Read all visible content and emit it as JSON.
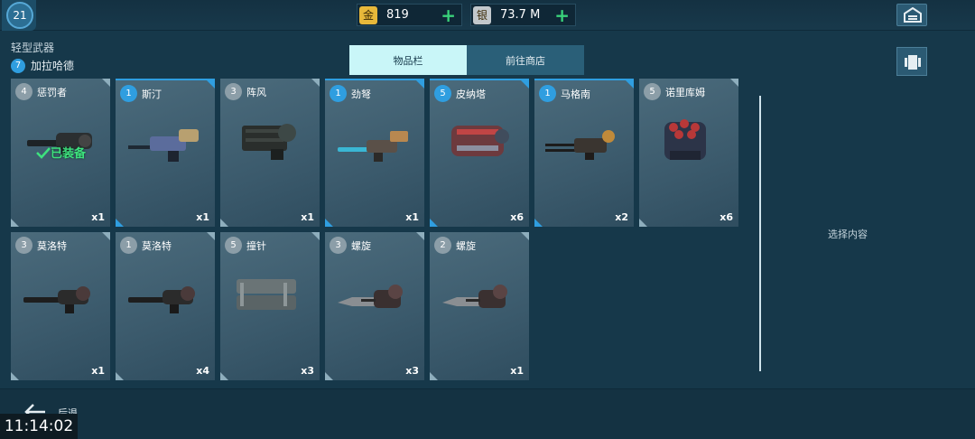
{
  "topbar": {
    "level": "21",
    "gold": {
      "icon_char": "金",
      "value": "819",
      "plus": "+"
    },
    "silver": {
      "icon_char": "银",
      "value": "73.7 M",
      "plus": "+"
    }
  },
  "header": {
    "category": "轻型武器",
    "character": {
      "level": "7",
      "name": "加拉哈德"
    },
    "tabs": [
      {
        "label": "物品栏",
        "active": true
      },
      {
        "label": "前往商店",
        "active": false
      }
    ]
  },
  "items": [
    {
      "level": "4",
      "name": "惩罚者",
      "qty": "x1",
      "tier": "gray",
      "equipped": true,
      "art": "punisher"
    },
    {
      "level": "1",
      "name": "斯汀",
      "qty": "x1",
      "tier": "blue",
      "equipped": false,
      "art": "sting"
    },
    {
      "level": "3",
      "name": "阵风",
      "qty": "x1",
      "tier": "gray",
      "equipped": false,
      "art": "gust"
    },
    {
      "level": "1",
      "name": "劲弩",
      "qty": "x1",
      "tier": "blue",
      "equipped": false,
      "art": "crossbow"
    },
    {
      "level": "5",
      "name": "皮纳塔",
      "qty": "x6",
      "tier": "blue",
      "equipped": false,
      "art": "pinata"
    },
    {
      "level": "1",
      "name": "马格南",
      "qty": "x2",
      "tier": "blue",
      "equipped": false,
      "art": "magnum"
    },
    {
      "level": "5",
      "name": "诺里库姆",
      "qty": "x6",
      "tier": "gray",
      "equipped": false,
      "art": "noricum"
    },
    {
      "level": "3",
      "name": "莫洛特",
      "qty": "x1",
      "tier": "gray",
      "equipped": false,
      "art": "molot"
    },
    {
      "level": "1",
      "name": "莫洛特",
      "qty": "x4",
      "tier": "gray",
      "equipped": false,
      "art": "molot"
    },
    {
      "level": "5",
      "name": "撞针",
      "qty": "x3",
      "tier": "gray",
      "equipped": false,
      "art": "pin"
    },
    {
      "level": "3",
      "name": "螺旋",
      "qty": "x3",
      "tier": "gray",
      "equipped": false,
      "art": "spiral"
    },
    {
      "level": "2",
      "name": "螺旋",
      "qty": "x1",
      "tier": "gray",
      "equipped": false,
      "art": "spiral"
    }
  ],
  "equipped_label": "已装备",
  "detail_panel": {
    "hint": "选择内容"
  },
  "footer": {
    "back_label": "后退",
    "clock": "11:14:02"
  },
  "colors": {
    "accent_blue": "#2f9ee0",
    "equipped_green": "#3ee27e",
    "tab_active": "#c9f6f8"
  }
}
